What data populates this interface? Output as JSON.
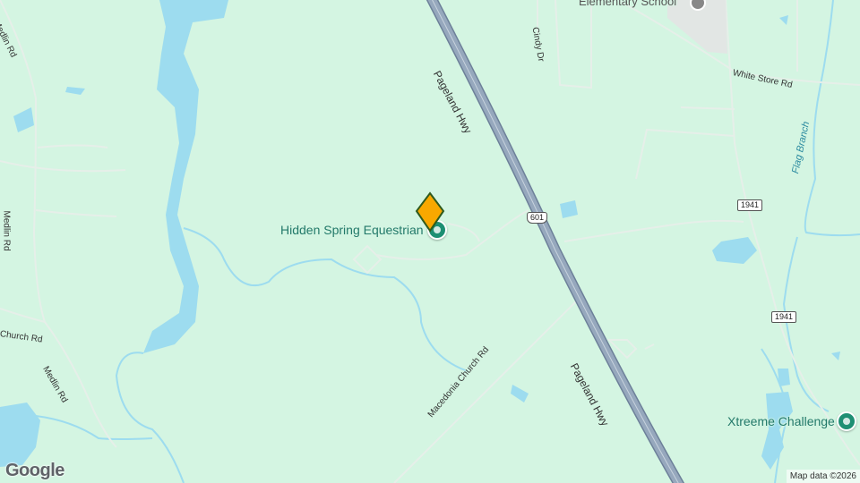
{
  "map": {
    "roads": {
      "pageland_hwy": "Pageland Hwy",
      "pageland_hwy_2": "Pageland Hwy",
      "medlin_rd_1": "Medlin Rd",
      "medlin_rd_2": "Medlin Rd",
      "medlin_rd_3": "Medlin Rd",
      "white_store_rd": "White Store Rd",
      "macedonia_church_rd": "Macedonia Church Rd",
      "church_rd": "Church Rd",
      "cindy_dr": "Cindy Dr"
    },
    "shields": {
      "us601": "601",
      "r1941_a": "1941",
      "r1941_b": "1941"
    },
    "water": {
      "flag_branch": "Flag Branch"
    },
    "places": {
      "elementary_school": "Elementary School",
      "hidden_spring": "Hidden Spring Equestrian",
      "xtreeme": "Xtreeme Challenge"
    },
    "branding": {
      "logo": "Google",
      "attribution": "Map data ©2026"
    },
    "colors": {
      "land": "#d4f5e2",
      "water": "#9ddcef",
      "highway": "#8a9eb5",
      "road": "#e8eaea",
      "marker": "#f8a800",
      "poi": "#1e8f73"
    }
  }
}
